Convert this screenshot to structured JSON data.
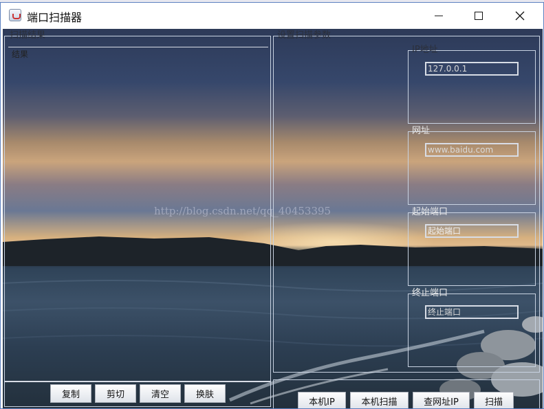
{
  "window": {
    "title": "端口扫描器",
    "icon": "java-cup-icon"
  },
  "scan_results": {
    "group_title": "扫描结果",
    "header": "结果",
    "buttons": {
      "copy": "复制",
      "cut": "剪切",
      "clear": "清空",
      "skin": "换肤"
    }
  },
  "scan_settings": {
    "group_title": "设置扫描参数",
    "ip_address": {
      "title": "IP地址",
      "value": "127.0.0.1"
    },
    "url": {
      "title": "网址",
      "value": "www.baidu.com"
    },
    "start_port": {
      "title": "起始端口",
      "value": "起始端口"
    },
    "end_port": {
      "title": "终止端口",
      "value": "终止端口"
    },
    "buttons": {
      "local_ip": "本机IP",
      "local_scan": "本机扫描",
      "lookup_url_ip": "查网址IP",
      "scan": "扫描"
    }
  },
  "watermark": "http://blog.csdn.net/qq_40453395"
}
